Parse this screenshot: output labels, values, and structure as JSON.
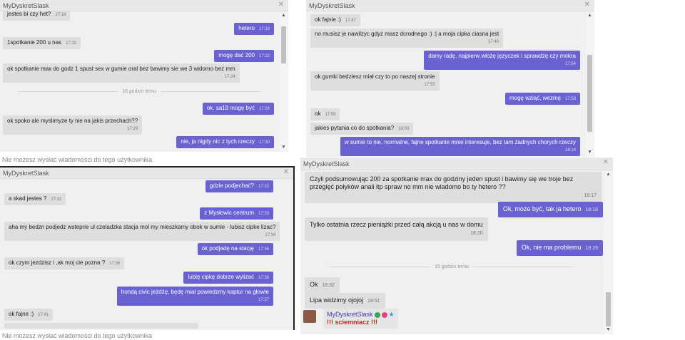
{
  "panel1": {
    "title": "MyDyskretSlask",
    "messages": [
      {
        "text": "jestes bi czy het?",
        "time": "17:18"
      },
      {
        "text": "hetero",
        "time": "17:19"
      },
      {
        "text": "1spotkanie 200 u nas",
        "time": "17:20"
      },
      {
        "text": "mogę dać 200",
        "time": "17:22"
      },
      {
        "text": "ok spotkanie max do godz 1 spust sex w gumie oral bez bawimy sie we 3 widomo bez mm",
        "time": "17:24"
      },
      {
        "text": "ok. sa19 mogę być",
        "time": "17:28"
      },
      {
        "text": "ok spoko ale myslimyze ty nie na jakis przechach??",
        "time": "17:29"
      },
      {
        "text": "nie, ja nigdy nic z tych rzeczy",
        "time": "17:30"
      }
    ],
    "separator": "16 godzin temu"
  },
  "notice1": "Nie możesz wysłać wiadomości do tego użytkownika",
  "panel2": {
    "title": "MyDyskretSlask",
    "messages": [
      {
        "text": "ok fajnie :)",
        "time": "17:47"
      },
      {
        "text": "no musisz je nawilzyc gdyz masz dcrodnego :) :| a moja cipka ciasna jest",
        "time": "17:46"
      },
      {
        "text": "damy radę, najpierw włożę języczek i sprawdzę czy mokra",
        "time": "17:54"
      },
      {
        "text": "ok gumki bedziesz miał czy to po naszej stronie",
        "time": "17:55"
      },
      {
        "text": "mogę wziąć, wezmę",
        "time": "17:58"
      },
      {
        "text": "ok",
        "time": "17:59"
      },
      {
        "text": "jakies pytania co do spotkania?",
        "time": "18:00"
      },
      {
        "text": "w sumie to nie, normalne, fajne spotkanie mnie interesuje, bez tam żadnych chorych rzeczy",
        "time": "18:14"
      }
    ]
  },
  "panel3": {
    "title": "MyDyskretSlask",
    "messages": [
      {
        "text": "gdzie podjechać?",
        "time": "17:32"
      },
      {
        "text": "a skad jestes ?",
        "time": "17:32"
      },
      {
        "text": "z Mysłowic centrum",
        "time": "17:33"
      },
      {
        "text": "aha my bedzn podjedz wsteprie ul czeladzka stacja mol my mieszkamy obok w sumie - lubisz cipke lizac?",
        "time": "17:34"
      },
      {
        "text": "ok podjadę na stację",
        "time": "17:35"
      },
      {
        "text": "ok czym jezdzisz i ,ak moj cie pozna ?",
        "time": "17:36"
      },
      {
        "text": "lubię cipkę dobrze wylizać",
        "time": "17:36"
      },
      {
        "text": "hondą civic jeżdżę, będę miał powiedzmy kaptur na głowie",
        "time": "17:37"
      },
      {
        "text": "ok fajne :)",
        "time": "17:41"
      }
    ]
  },
  "notice2": "Nie możesz wysłać wiadomości do tego użytkownika",
  "panel4": {
    "title": "MyDyskretSlask",
    "messages": [
      {
        "text": "Czyli podsumowując 200 za spotkanie max do godziny jeden spust i bawimy się we troje bez przegięć połyków anali itp spraw no mm nie wiadomo bo ty hetero ??",
        "time": "18:17"
      },
      {
        "text": "Ok, może być, tak ja hetero",
        "time": "18:18"
      },
      {
        "text": "Tylko ostatnia rzecz pieniążki przed całą akcją u nas w domu",
        "time": "18:20"
      },
      {
        "text": "Ok, nie ma problemu",
        "time": "18:29"
      },
      {
        "text": "Ok",
        "time": "18:32"
      },
      {
        "text": "Lipa widzimy ojojoj",
        "time": "18:51"
      }
    ],
    "separator": "15 godzin temu",
    "user": {
      "name": "MyDyskretSlask",
      "status": "!!! sciemniacz !!!"
    }
  },
  "colors": {
    "outgoing": "#6a62d0",
    "incoming": "#dedede",
    "panel": "#f0f0f0"
  }
}
